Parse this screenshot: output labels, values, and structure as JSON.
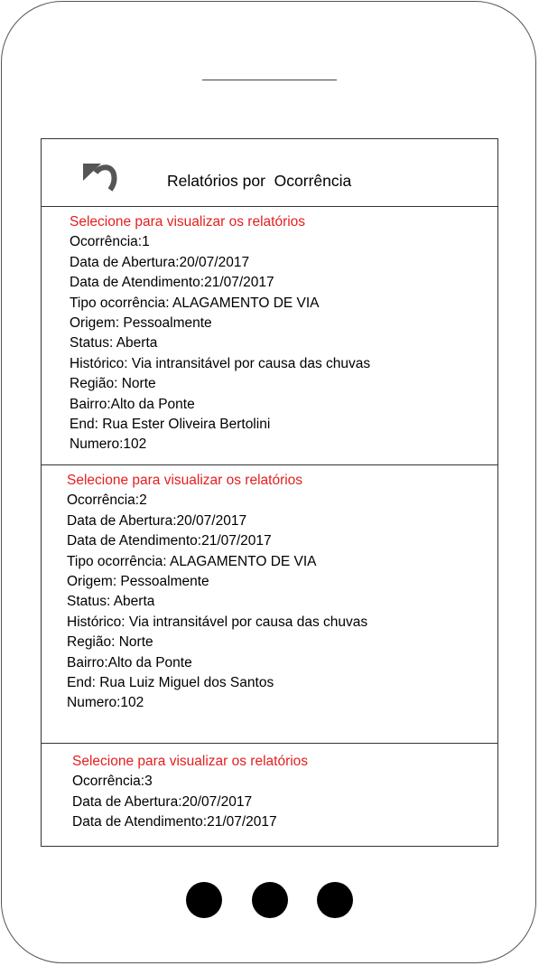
{
  "header": {
    "title": "Relatórios por  Ocorrência",
    "back_icon": "undo-arrow-icon"
  },
  "occurrences": [
    {
      "prompt": "Selecione para visualizar os relatórios",
      "occurrence": "Ocorrência:1",
      "opened": "Data de Abertura:20/07/2017",
      "attended": "Data de Atendimento:21/07/2017",
      "type": "Tipo ocorrência: ALAGAMENTO DE VIA",
      "origin": "Origem: Pessoalmente",
      "status": "Status: Aberta",
      "history": "Histórico: Via intransitável por causa das chuvas",
      "region": "Região: Norte",
      "district": "Bairro:Alto da Ponte",
      "address": "End: Rua Ester Oliveira Bertolini",
      "number": "Numero:102"
    },
    {
      "prompt": "Selecione para visualizar os relatórios",
      "occurrence": "Ocorrência:2",
      "opened": "Data de Abertura:20/07/2017",
      "attended": "Data de Atendimento:21/07/2017",
      "type": "Tipo ocorrência: ALAGAMENTO DE VIA",
      "origin": "Origem: Pessoalmente",
      "status": "Status: Aberta",
      "history": "Histórico: Via intransitável por causa das chuvas",
      "region": "Região: Norte",
      "district": "Bairro:Alto da Ponte",
      "address": "End: Rua Luiz Miguel dos Santos",
      "number": "Numero:102"
    },
    {
      "prompt": "Selecione para visualizar os relatórios",
      "occurrence": "Ocorrência:3",
      "opened": "Data de Abertura:20/07/2017",
      "attended": "Data de Atendimento:21/07/2017"
    }
  ],
  "colors": {
    "prompt": "#e41e1e",
    "outline": "#333333"
  }
}
